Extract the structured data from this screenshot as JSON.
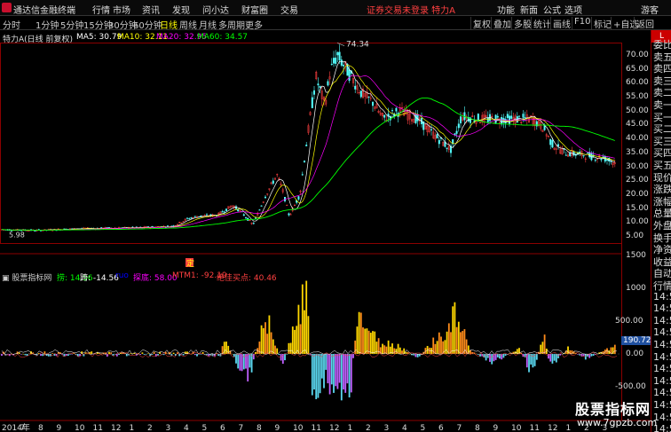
{
  "menubar": {
    "app_name": "通达信金融终端",
    "items": [
      "行情",
      "市场",
      "资讯",
      "发现",
      "问小达",
      "财富圈",
      "交易"
    ],
    "status": "证券交易未登录  特力A",
    "right_items": [
      "功能",
      "新面",
      "公式",
      "选项",
      "游客"
    ]
  },
  "toolbar": {
    "periods": [
      "分时",
      "1分钟",
      "5分钟",
      "15分钟",
      "30分钟",
      "60分钟",
      "日线",
      "周线",
      "月线",
      "多周期",
      "更多"
    ],
    "active_period": "日线",
    "right_buttons": [
      "复权",
      "叠加",
      "多股",
      "统计",
      "画线",
      "F10",
      "标记",
      "+自选",
      "返回"
    ]
  },
  "price_panel": {
    "title": "特力A(日线 前复权)",
    "ma": [
      {
        "label": "MA5: 30.79",
        "color": "#ffffff"
      },
      {
        "label": "MA10: 32.11",
        "color": "#ffff00"
      },
      {
        "label": "MA20: 32.95",
        "color": "#ff00ff"
      },
      {
        "label": "MA60: 34.57",
        "color": "#00ff00"
      }
    ],
    "high_label": "74.34",
    "low_label": "5.98",
    "marker": "定",
    "y_ticks": [
      "70.00",
      "65.00",
      "60.00",
      "55.00",
      "50.00",
      "45.00",
      "40.00",
      "35.00",
      "30.00",
      "25.00",
      "20.00",
      "15.00",
      "10.00",
      "5.00"
    ]
  },
  "indicator_panel": {
    "name": "股票指标网",
    "items": [
      {
        "label": "捞: 14.56",
        "color": "#00ff00"
      },
      {
        "label": "跨: -14.56",
        "color": "#ffffff"
      },
      {
        "label": "ruo",
        "color": "#0000ff"
      },
      {
        "label": "探底: 58.00",
        "color": "#ff00ff"
      },
      {
        "label": "MTM1: -92.19",
        "color": "#ff4040"
      },
      {
        "label": "绝佳买点: 40.46",
        "color": "#ff4040"
      }
    ],
    "y_ticks": [
      "1500",
      "1000",
      "500.00",
      "0.00",
      "-500.00"
    ],
    "current_value": "190.72"
  },
  "x_axis": [
    "2014年",
    "7",
    "8",
    "9",
    "10",
    "11",
    "12",
    "1",
    "2",
    "3",
    "4",
    "5",
    "6",
    "7",
    "8",
    "9",
    "10",
    "11",
    "12",
    "1",
    "2",
    "3",
    "4",
    "5",
    "6",
    "7",
    "8",
    "9",
    "10",
    "11",
    "12",
    "1",
    "2",
    "3"
  ],
  "side_panel": {
    "items": [
      "委比",
      "卖五",
      "卖四",
      "卖三",
      "卖二",
      "卖一",
      "买一",
      "买二",
      "买三",
      "买四",
      "买五",
      "现价",
      "涨跌",
      "涨幅",
      "总量",
      "外盘",
      "换手",
      "净资",
      "收益",
      "自动",
      "行情",
      "14:5",
      "14:5",
      "14:5",
      "14:5",
      "14:5",
      "14:5",
      "14:5",
      "14:5",
      "14:5",
      "14:5",
      "14:5",
      "14:5"
    ]
  },
  "watermark": {
    "title": "股票指标网",
    "url": "www.7gpzb.com"
  },
  "colors": {
    "up": "#ff4040",
    "down": "#54ffff",
    "ma5": "#ffffff",
    "ma10": "#ffff00",
    "ma20": "#ff00ff",
    "ma60": "#00ff00",
    "bar_orange": "#ff8c1a",
    "bar_yellow": "#ffd700",
    "bar_cyan": "#5ad8f0",
    "bar_magenta": "#c060ff"
  }
}
